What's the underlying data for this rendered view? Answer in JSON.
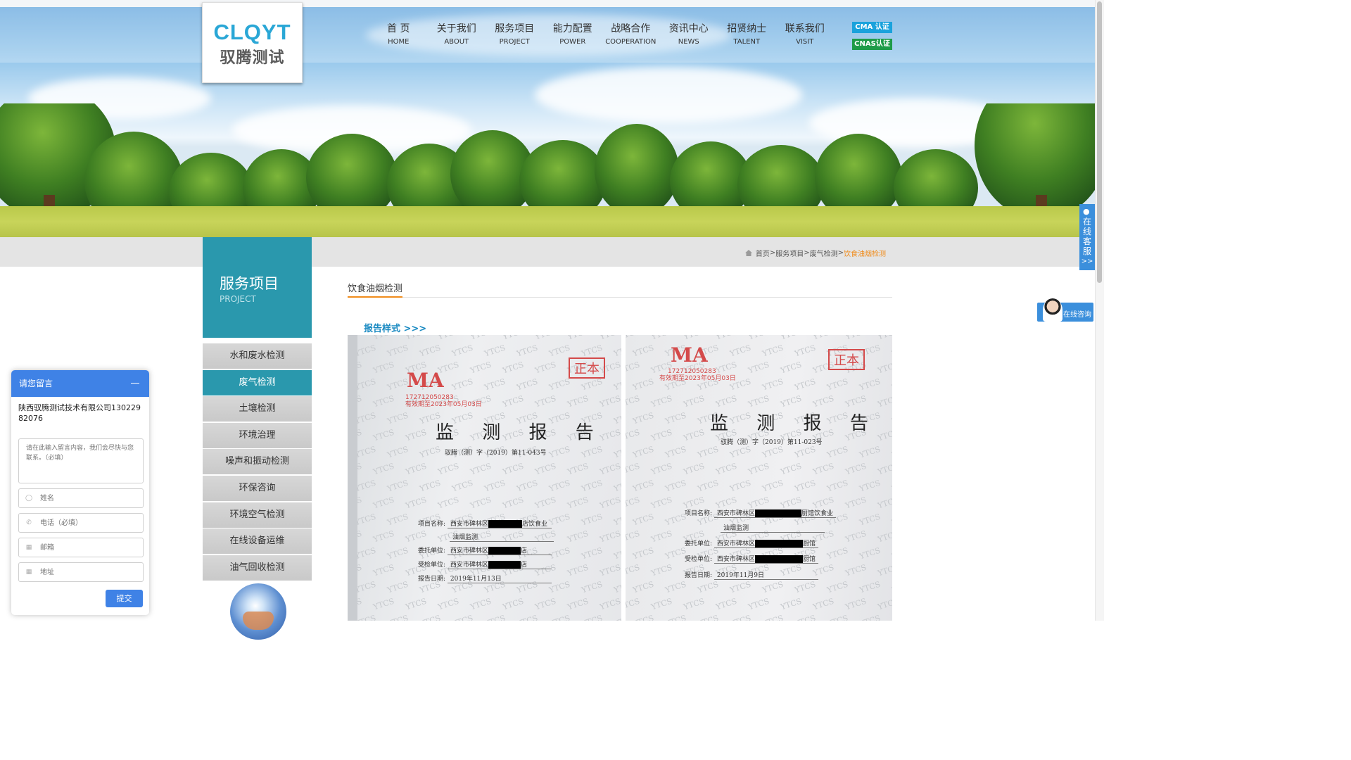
{
  "logo": {
    "en": "CLQYT",
    "cn": "驭腾测试"
  },
  "nav": [
    {
      "cn": "首 页",
      "en": "HOME"
    },
    {
      "cn": "关于我们",
      "en": "ABOUT"
    },
    {
      "cn": "服务项目",
      "en": "PROJECT"
    },
    {
      "cn": "能力配置",
      "en": "POWER"
    },
    {
      "cn": "战略合作",
      "en": "COOPERATION"
    },
    {
      "cn": "资讯中心",
      "en": "NEWS"
    },
    {
      "cn": "招贤纳士",
      "en": "TALENT"
    },
    {
      "cn": "联系我们",
      "en": "VISIT"
    }
  ],
  "badges": {
    "cma": "CMA 认证",
    "cnas": "CNAS认证"
  },
  "breadcrumb": {
    "home": "首页",
    "sep": ">",
    "l1": "服务项目",
    "l2": "废气检测",
    "current": "饮食油烟检测"
  },
  "sidebar": {
    "title_cn": "服务项目",
    "title_en": "PROJECT",
    "items": [
      "水和废水检测",
      "废气检测",
      "土壤检测",
      "环境治理",
      "噪声和振动检测",
      "环保咨询",
      "环境空气检测",
      "在线设备运维",
      "油气回收检测"
    ],
    "active_index": 1
  },
  "content": {
    "title": "饮食油烟检测",
    "report_heading": "报告样式  >>>"
  },
  "reports": [
    {
      "stamp_ma": "MA",
      "stamp_no": "172712050283",
      "stamp_valid": "有效期至2023年05月03日",
      "seal": "正本",
      "heading": "监 测 报 告",
      "number": "驭腾（测）字（2019）第11-043号",
      "rows": [
        {
          "label": "项目名称:",
          "value": "西安市碑林区",
          "suffix": "店饮食业"
        },
        {
          "label": "",
          "value": "油烟监测",
          "suffix": ""
        },
        {
          "label": "委托单位:",
          "value": "西安市碑林区",
          "suffix": "店"
        },
        {
          "label": "受检单位:",
          "value": "西安市碑林区",
          "suffix": "店"
        },
        {
          "label": "报告日期:",
          "value": "2019年11月13日",
          "suffix": ""
        }
      ]
    },
    {
      "stamp_ma": "MA",
      "stamp_no": "172712050283",
      "stamp_valid": "有效期至2023年05月03日",
      "seal": "正本",
      "heading": "监 测 报 告",
      "number": "驭腾（测）字（2019）第11-023号",
      "rows": [
        {
          "label": "项目名称:",
          "value": "西安市碑林区",
          "suffix": "厨馆饮食业"
        },
        {
          "label": "",
          "value": "油烟监测",
          "suffix": ""
        },
        {
          "label": "委托单位:",
          "value": "西安市碑林区",
          "suffix": "厨馆"
        },
        {
          "label": "受检单位:",
          "value": "西安市碑林区",
          "suffix": "厨馆"
        },
        {
          "label": "报告日期:",
          "value": "2019年11月9日",
          "suffix": ""
        }
      ]
    }
  ],
  "service_tab": {
    "text": "在线客服",
    "arrow": ">>"
  },
  "consult": {
    "label": "在线咨询"
  },
  "message": {
    "header": "请您留言",
    "company": "陕西驭腾测试技术有限公司13022982076",
    "content_placeholder": "请在此输入留言内容，我们会尽快与您联系。（必填）",
    "fields": [
      {
        "icon": "user-icon",
        "placeholder": "姓名"
      },
      {
        "icon": "phone-icon",
        "placeholder": "电话（必填）"
      },
      {
        "icon": "mail-icon",
        "placeholder": "邮箱"
      },
      {
        "icon": "location-icon",
        "placeholder": "地址"
      }
    ],
    "submit": "提交"
  },
  "colors": {
    "teal": "#2a98ad",
    "orange": "#f08c1c",
    "blue": "#3f82e6",
    "cma": "#1aa2dc",
    "cnas": "#1e9b48"
  }
}
